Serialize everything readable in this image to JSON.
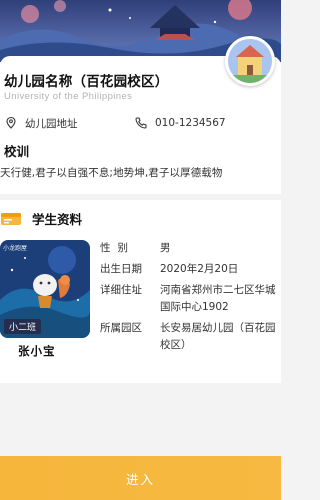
{
  "school": {
    "name": "幼儿园名称（百花园校区）",
    "name_en": "University of the Philippines",
    "address_label": "幼儿园地址",
    "phone": "010-1234567"
  },
  "motto": {
    "title": "校训",
    "text": "天行健,君子以自强不息;地势坤,君子以厚德载物"
  },
  "student": {
    "section_title": "学生资料",
    "name": "张小宝",
    "class_tag": "小二班",
    "photo_brand": "小龙跑屋",
    "fields": [
      {
        "label": "性别",
        "value": "男"
      },
      {
        "label": "出生日期",
        "value": "2020年2月20日"
      },
      {
        "label": "详细住址",
        "value": "河南省郑州市二七区华城国际中心1902"
      },
      {
        "label": "所属园区",
        "value": "长安易居幼儿园（百花园校区）"
      }
    ]
  },
  "footer": {
    "enter_label": "进入"
  },
  "colors": {
    "accent": "#f6b63c",
    "banner_sky": "#3b4f8f"
  },
  "icons": [
    "location-icon",
    "phone-icon",
    "student-card-icon"
  ]
}
